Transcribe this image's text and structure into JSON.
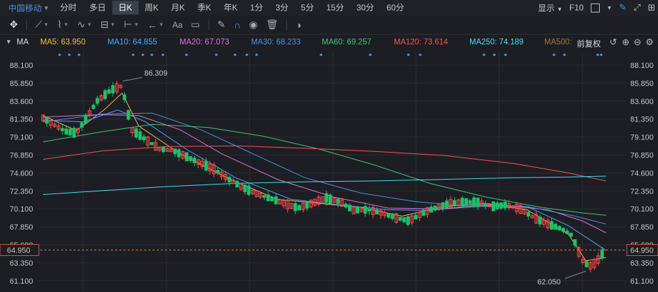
{
  "period_bar": {
    "ticker": "中国移动",
    "fav_icon": "▾",
    "tabs": [
      "分时",
      "多日",
      "日K",
      "周K",
      "月K",
      "季K",
      "年K",
      "1分",
      "3分",
      "5分",
      "15分",
      "30分",
      "60分"
    ],
    "active_tab": "日K",
    "display_label": "显示",
    "f10_label": "F10"
  },
  "toolbar": {
    "text_tool_label": "Aa"
  },
  "ma_bar": {
    "toggle_label": "MA",
    "items": [
      {
        "label": "MA5: 63.950",
        "color": "#f0c040"
      },
      {
        "label": "MA10: 64.855",
        "color": "#4aa8ff"
      },
      {
        "label": "MA20: 67.073",
        "color": "#e070e0"
      },
      {
        "label": "MA30: 68.233",
        "color": "#4a8fe8"
      },
      {
        "label": "MA60: 69.257",
        "color": "#3cc878"
      },
      {
        "label": "MA120: 73.614",
        "color": "#ff5050"
      },
      {
        "label": "MA250: 74.189",
        "color": "#40e0f0"
      },
      {
        "label": "MA500:",
        "color": "#9a7a40"
      }
    ],
    "adjust_label": "前复权"
  },
  "y_axis": [
    "88.100",
    "85.850",
    "83.600",
    "81.350",
    "79.100",
    "76.850",
    "74.600",
    "72.350",
    "70.100",
    "67.850",
    "65.600",
    "63.350",
    "61.100"
  ],
  "current_price": "64.950",
  "annotations": {
    "high": "86.309",
    "low": "62.050"
  },
  "colors": {
    "up": "#ff4a4a",
    "down": "#1fc06a",
    "grid": "#2a2d33",
    "price_line": "#e08040"
  }
}
